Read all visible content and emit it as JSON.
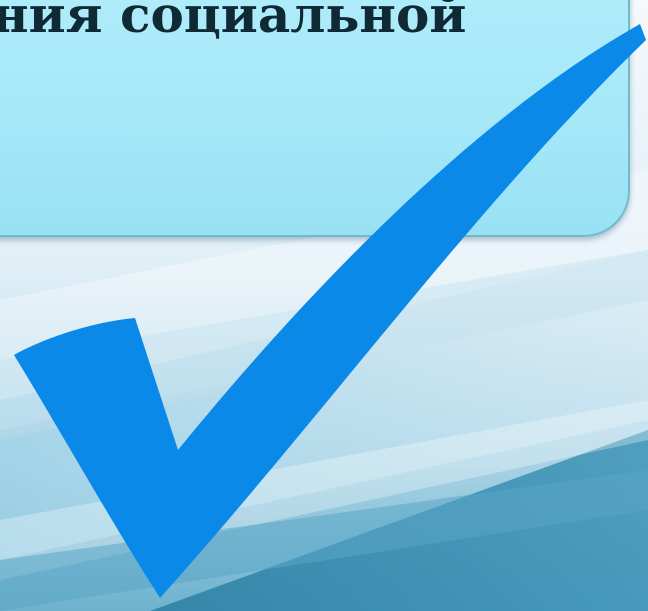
{
  "slide": {
    "title_text": "ния социальной"
  },
  "colors": {
    "title_box_fill": "#a6e8f8",
    "title_box_border": "#73b9cc",
    "title_text": "#0f2a35",
    "checkmark": "#0a89e8",
    "background_light": "#eef5fa",
    "background_dark": "#1e6f8e"
  },
  "icons": {
    "checkmark": "checkmark-icon"
  }
}
